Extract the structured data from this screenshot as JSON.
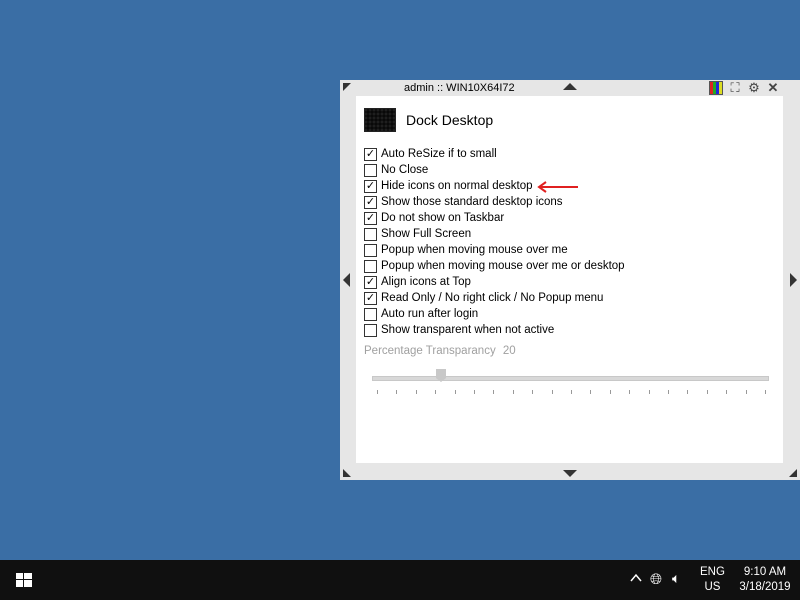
{
  "dock": {
    "title": "admin :: WIN10X64I72",
    "header_title": "Dock Desktop",
    "options": [
      {
        "label": "Auto ReSize if to small",
        "checked": true
      },
      {
        "label": "No Close",
        "checked": false
      },
      {
        "label": "Hide icons on normal desktop",
        "checked": true
      },
      {
        "label": "Show those standard desktop icons",
        "checked": true
      },
      {
        "label": "Do not show on Taskbar",
        "checked": true
      },
      {
        "label": "Show Full Screen",
        "checked": false
      },
      {
        "label": "Popup when moving mouse over me",
        "checked": false
      },
      {
        "label": "Popup when moving mouse over me or desktop",
        "checked": false
      },
      {
        "label": "Align icons at Top",
        "checked": true
      },
      {
        "label": "Read Only / No right click / No Popup menu",
        "checked": true
      },
      {
        "label": "Auto run after login",
        "checked": false
      },
      {
        "label": "Show transparent when not active",
        "checked": false
      }
    ],
    "transparency_label": "Percentage Transparancy",
    "transparency_value": "20",
    "icons": [
      "palette-icon",
      "fullscreen-icon",
      "gear-icon",
      "close-icon"
    ],
    "accent_arrow_color": "#e02020"
  },
  "taskbar": {
    "lang_top": "ENG",
    "lang_bottom": "US",
    "time": "9:10 AM",
    "date": "3/18/2019"
  }
}
